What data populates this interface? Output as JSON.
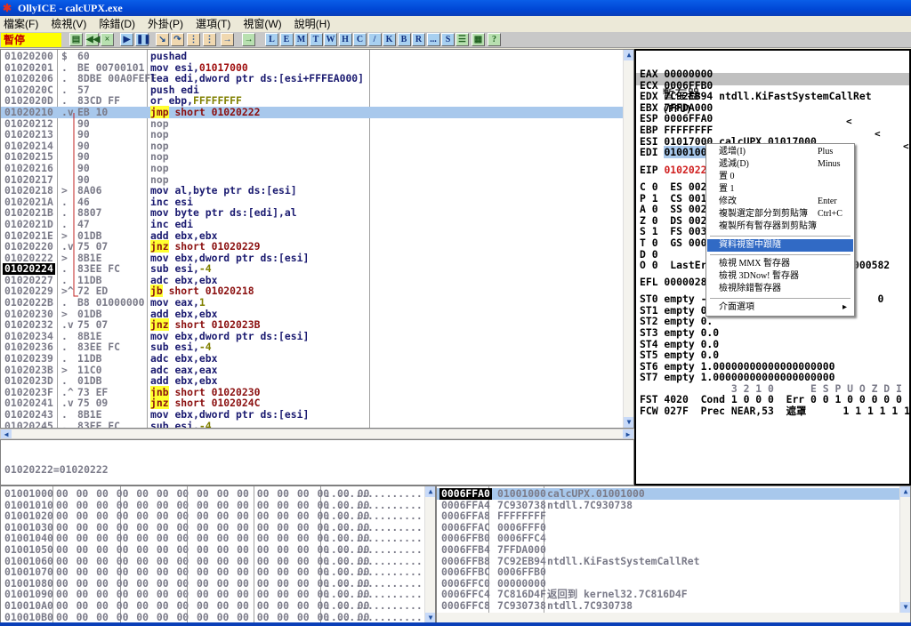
{
  "window": {
    "title": "OllyICE - calcUPX.exe",
    "icon": "bug-icon"
  },
  "menu": [
    "檔案(F)",
    "檢視(V)",
    "除錯(D)",
    "外掛(P)",
    "選項(T)",
    "視窗(W)",
    "說明(H)"
  ],
  "toolbar": {
    "status": "暫停",
    "buttons": [
      {
        "icon": "open-icon",
        "t": "▤",
        "c": "g"
      },
      {
        "icon": "restart-icon",
        "t": "◀◀",
        "c": "g"
      },
      {
        "icon": "close-icon",
        "t": "×",
        "c": "g"
      },
      {
        "icon": "run-icon",
        "t": "▶",
        "c": "b"
      },
      {
        "icon": "pause-icon",
        "t": "❚❚",
        "c": "b"
      },
      {
        "icon": "step-into-icon",
        "t": "↘",
        "c": "o"
      },
      {
        "icon": "step-over-icon",
        "t": "↷",
        "c": "o"
      },
      {
        "icon": "trace-into-icon",
        "t": "⋮",
        "c": "o"
      },
      {
        "icon": "trace-over-icon",
        "t": "⋮",
        "c": "o"
      },
      {
        "icon": "execute-till-return-icon",
        "t": "→",
        "c": "o"
      },
      {
        "icon": "goto-icon",
        "t": "→",
        "c": "g"
      }
    ],
    "letters": [
      "L",
      "E",
      "M",
      "T",
      "W",
      "H",
      "C",
      "/",
      "K",
      "B",
      "R",
      "...",
      "S"
    ],
    "right_buttons": [
      {
        "icon": "list-icon",
        "t": "☰"
      },
      {
        "icon": "colors-icon",
        "t": "▦"
      },
      {
        "icon": "help-icon",
        "t": "?"
      }
    ]
  },
  "disasm": {
    "selected_index": 5,
    "current_index": 19,
    "rows": [
      {
        "a": "01020200",
        "m": "$",
        "h": "60",
        "op": "pushad",
        "args": ""
      },
      {
        "a": "01020201",
        "m": ".",
        "h": "BE 00700101",
        "op": "mov",
        "args": "esi,",
        "imm": "01017000",
        "ic": "a"
      },
      {
        "a": "01020206",
        "m": ".",
        "h": "8DBE 00A0FEFF",
        "op": "lea",
        "args": "edi,dword ptr ds:[esi+FFFEA000]"
      },
      {
        "a": "0102020C",
        "m": ".",
        "h": "57",
        "op": "push",
        "args": "edi"
      },
      {
        "a": "0102020D",
        "m": ".",
        "h": "83CD FF",
        "op": "or",
        "args": "ebp,",
        "imm": "FFFFFFFF",
        "ic": "n"
      },
      {
        "a": "01020210",
        "m": ".v",
        "h": "EB 10",
        "op": "jmp",
        "args": "short 01020222",
        "j": true
      },
      {
        "a": "01020212",
        "m": "",
        "h": "90",
        "op": "nop",
        "args": "",
        "nop": true
      },
      {
        "a": "01020213",
        "m": "",
        "h": "90",
        "op": "nop",
        "args": "",
        "nop": true
      },
      {
        "a": "01020214",
        "m": "",
        "h": "90",
        "op": "nop",
        "args": "",
        "nop": true
      },
      {
        "a": "01020215",
        "m": "",
        "h": "90",
        "op": "nop",
        "args": "",
        "nop": true
      },
      {
        "a": "01020216",
        "m": "",
        "h": "90",
        "op": "nop",
        "args": "",
        "nop": true
      },
      {
        "a": "01020217",
        "m": "",
        "h": "90",
        "op": "nop",
        "args": "",
        "nop": true
      },
      {
        "a": "01020218",
        "m": ">",
        "h": "8A06",
        "op": "mov",
        "args": "al,byte ptr ds:[esi]"
      },
      {
        "a": "0102021A",
        "m": ".",
        "h": "46",
        "op": "inc",
        "args": "esi"
      },
      {
        "a": "0102021B",
        "m": ".",
        "h": "8807",
        "op": "mov",
        "args": "byte ptr ds:[edi],al"
      },
      {
        "a": "0102021D",
        "m": ".",
        "h": "47",
        "op": "inc",
        "args": "edi"
      },
      {
        "a": "0102021E",
        "m": ">",
        "h": "01DB",
        "op": "add",
        "args": "ebx,ebx"
      },
      {
        "a": "01020220",
        "m": ".v",
        "h": "75 07",
        "op": "jnz",
        "args": "short 01020229",
        "j": true
      },
      {
        "a": "01020222",
        "m": ">",
        "h": "8B1E",
        "op": "mov",
        "args": "ebx,dword ptr ds:[esi]"
      },
      {
        "a": "01020224",
        "m": ".",
        "h": "83EE FC",
        "op": "sub",
        "args": "esi,",
        "imm": "-4",
        "ic": "n"
      },
      {
        "a": "01020227",
        "m": ".",
        "h": "11DB",
        "op": "adc",
        "args": "ebx,ebx"
      },
      {
        "a": "01020229",
        "m": ">^",
        "h": "72 ED",
        "op": "jb",
        "args": "short 01020218",
        "j": true
      },
      {
        "a": "0102022B",
        "m": ".",
        "h": "B8 01000000",
        "op": "mov",
        "args": "eax,",
        "imm": "1",
        "ic": "n"
      },
      {
        "a": "01020230",
        "m": ">",
        "h": "01DB",
        "op": "add",
        "args": "ebx,ebx"
      },
      {
        "a": "01020232",
        "m": ".v",
        "h": "75 07",
        "op": "jnz",
        "args": "short 0102023B",
        "j": true
      },
      {
        "a": "01020234",
        "m": ".",
        "h": "8B1E",
        "op": "mov",
        "args": "ebx,dword ptr ds:[esi]"
      },
      {
        "a": "01020236",
        "m": ".",
        "h": "83EE FC",
        "op": "sub",
        "args": "esi,",
        "imm": "-4",
        "ic": "n"
      },
      {
        "a": "01020239",
        "m": ".",
        "h": "11DB",
        "op": "adc",
        "args": "ebx,ebx"
      },
      {
        "a": "0102023B",
        "m": ">",
        "h": "11C0",
        "op": "adc",
        "args": "eax,eax"
      },
      {
        "a": "0102023D",
        "m": ".",
        "h": "01DB",
        "op": "add",
        "args": "ebx,ebx"
      },
      {
        "a": "0102023F",
        "m": ".^",
        "h": "73 EF",
        "op": "jnb",
        "args": "short 01020230",
        "j": true
      },
      {
        "a": "01020241",
        "m": ".v",
        "h": "75 09",
        "op": "jnz",
        "args": "short 0102024C",
        "j": true
      },
      {
        "a": "01020243",
        "m": ".",
        "h": "8B1E",
        "op": "mov",
        "args": "ebx,dword ptr ds:[esi]"
      },
      {
        "a": "01020245",
        "m": ".",
        "h": "83EE FC",
        "op": "sub",
        "args": "esi,",
        "imm": "-4",
        "ic": "n"
      }
    ]
  },
  "info": {
    "text": "01020222=01020222"
  },
  "registers": {
    "title": "暫存器",
    "title_suffix": "(FPU)",
    "lines": [
      {
        "t": "EAX 00000000"
      },
      {
        "t": "ECX 0006FFB0"
      },
      {
        "t": "EDX 7C92EB94 ntdll.KiFastSystemCallRet"
      },
      {
        "t": "EBX 7FFDA000"
      },
      {
        "t": "ESP 0006FFA0"
      },
      {
        "t": "EBP FFFFFFFF"
      },
      {
        "t": "ESI 01017000 calcUPX.01017000"
      },
      {
        "t": "EDI ",
        "v": "01001000",
        "hl": true
      },
      {
        "t": "EIP ",
        "v": "01020222",
        "red": true
      },
      {
        "t": "C 0  ES 0023"
      },
      {
        "t": "P 1  CS 001B"
      },
      {
        "t": "A 0  SS 0023"
      },
      {
        "t": "Z 0  DS 0023"
      },
      {
        "t": "S 1  FS 003B"
      },
      {
        "t": "T 0  GS 0000"
      },
      {
        "t": "D 0"
      },
      {
        "t": "O 0  LastErr                  S (00000582"
      },
      {
        "t": "EFL 00000286"
      },
      {
        "t": "ST0 empty -U                           0"
      },
      {
        "t": "ST1 empty 0."
      },
      {
        "t": "ST2 empty 0."
      },
      {
        "t": "ST3 empty 0.0"
      },
      {
        "t": "ST4 empty 0.0"
      },
      {
        "t": "ST5 empty 0.0"
      },
      {
        "t": "ST6 empty 1.00000000000000000000"
      },
      {
        "t": "ST7 empty 1.00000000000000000000"
      },
      {
        "t": "               3 2 1 0      E S P U O Z D I",
        "dim": true
      },
      {
        "t": "FST 4020  Cond 1 0 0 0  Err 0 0 1 0 0 0 0 0  (EQ)"
      },
      {
        "t": "FCW 027F  Prec NEAR,53  遮罩      1 1 1 1 1 1"
      }
    ]
  },
  "context_menu": {
    "items": [
      {
        "label": "遞增(I)",
        "shortcut": "Plus"
      },
      {
        "label": "遞減(D)",
        "shortcut": "Minus"
      },
      {
        "label": "置 0"
      },
      {
        "label": "置 1"
      },
      {
        "label": "修改",
        "shortcut": "Enter"
      },
      {
        "label": "複製選定部分到剪貼簿",
        "shortcut": "Ctrl+C"
      },
      {
        "label": "複製所有暫存器到剪貼簿"
      },
      {
        "sep": true
      },
      {
        "label": "資料視窗中跟隨",
        "highlighted": true
      },
      {
        "sep": true
      },
      {
        "label": "檢視 MMX 暫存器"
      },
      {
        "label": "檢視 3DNow! 暫存器"
      },
      {
        "label": "檢視除錯暫存器"
      },
      {
        "sep": true
      },
      {
        "label": "介面選項",
        "submenu": true
      }
    ]
  },
  "dump": {
    "rows": [
      {
        "a": "01001000"
      },
      {
        "a": "01001010"
      },
      {
        "a": "01001020"
      },
      {
        "a": "01001030"
      },
      {
        "a": "01001040"
      },
      {
        "a": "01001050"
      },
      {
        "a": "01001060"
      },
      {
        "a": "01001070"
      },
      {
        "a": "01001080"
      },
      {
        "a": "01001090"
      },
      {
        "a": "010010A0"
      },
      {
        "a": "010010B0"
      }
    ],
    "hex": "00 00 00 00 00 00 00 00 00 00 00 00 00 00 00 00",
    "ascii": "................"
  },
  "stack": {
    "rows": [
      {
        "a": "0006FFA0",
        "v": "01001000",
        "c": "calcUPX.01001000"
      },
      {
        "a": "0006FFA4",
        "v": "7C930738",
        "c": "ntdll.7C930738"
      },
      {
        "a": "0006FFA8",
        "v": "FFFFFFFF",
        "c": ""
      },
      {
        "a": "0006FFAC",
        "v": "0006FFF0",
        "c": ""
      },
      {
        "a": "0006FFB0",
        "v": "0006FFC4",
        "c": ""
      },
      {
        "a": "0006FFB4",
        "v": "7FFDA000",
        "c": ""
      },
      {
        "a": "0006FFB8",
        "v": "7C92EB94",
        "c": "ntdll.KiFastSystemCallRet"
      },
      {
        "a": "0006FFBC",
        "v": "0006FFB0",
        "c": ""
      },
      {
        "a": "0006FFC0",
        "v": "00000000",
        "c": ""
      },
      {
        "a": "0006FFC4",
        "v": "7C816D4F",
        "c": "返回到 kernel32.7C816D4F"
      },
      {
        "a": "0006FFC8",
        "v": "7C930738",
        "c": "ntdll.7C930738"
      }
    ]
  },
  "colors": {
    "title_bar": "#0046d5",
    "selection": "#a8c8ec",
    "menu_highlight": "#316ac5",
    "status_bg": "#ffff00",
    "jump_highlight": "#ffff30"
  }
}
